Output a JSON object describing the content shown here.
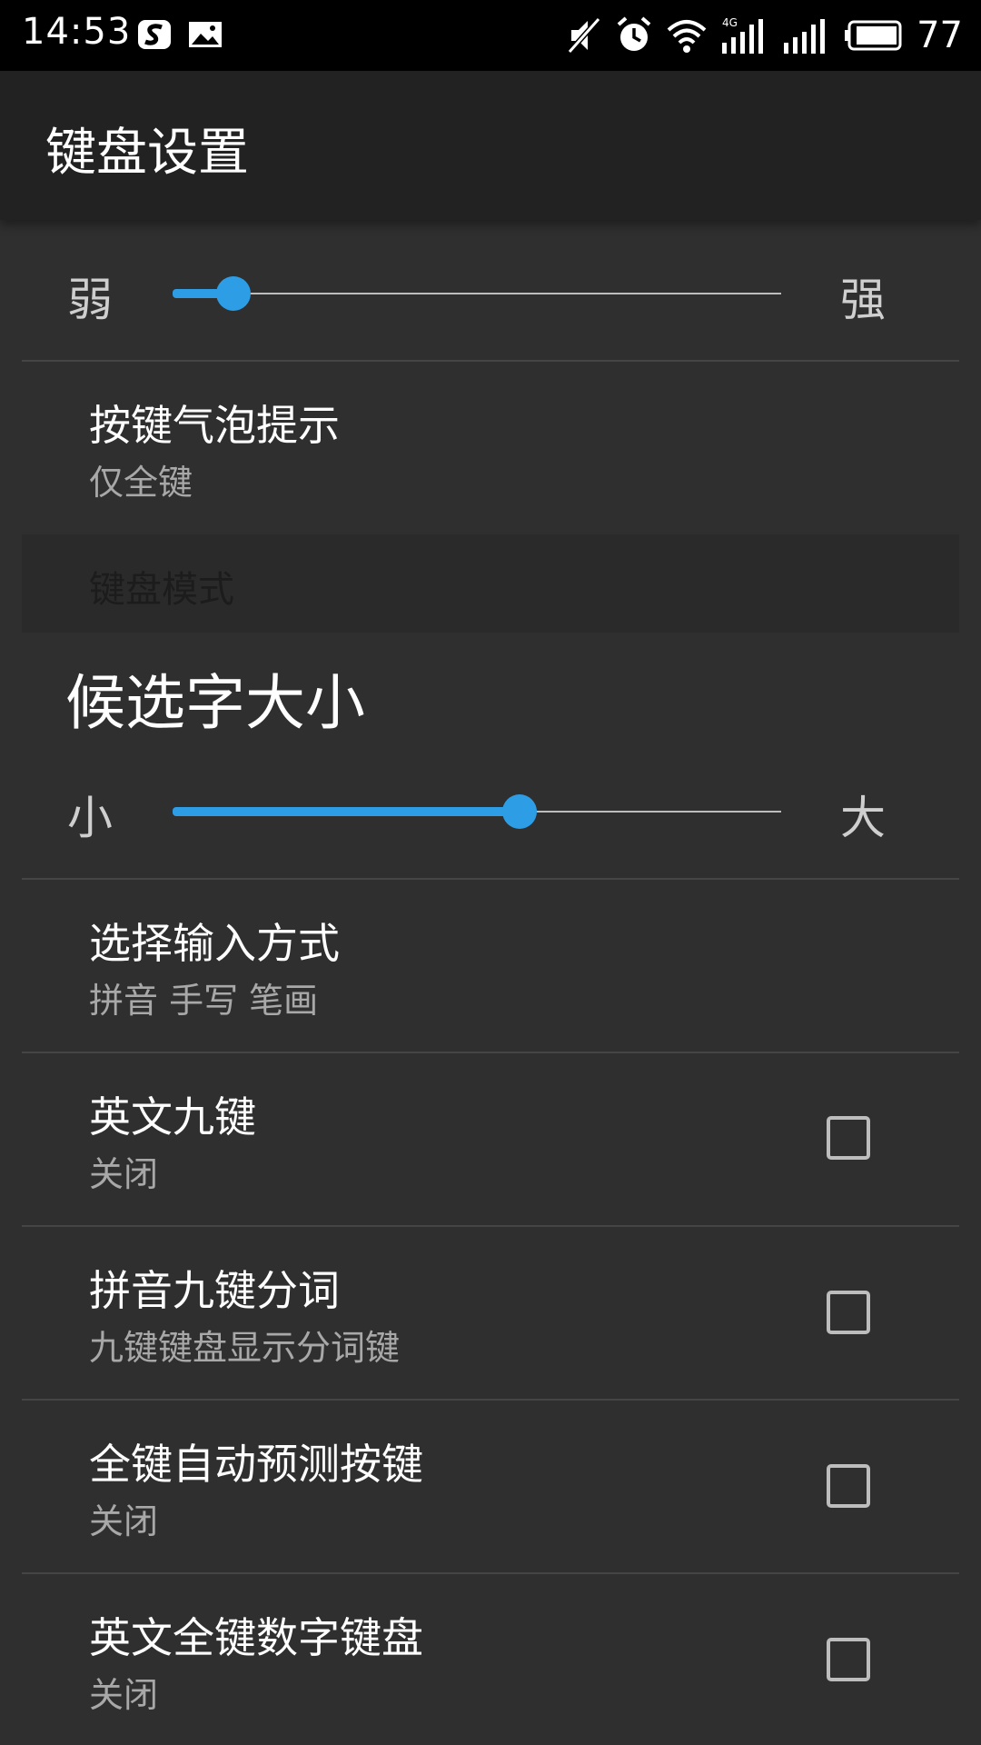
{
  "status_bar": {
    "time": "14:53",
    "battery": "77",
    "icons": [
      "sogou-app-icon",
      "gallery-icon",
      "mute-icon",
      "alarm-icon",
      "wifi-icon",
      "4g-signal-icon",
      "signal-icon",
      "battery-icon"
    ]
  },
  "app_bar": {
    "title": "键盘设置"
  },
  "vibration_slider": {
    "min_label": "弱",
    "max_label": "强",
    "value": 0.1
  },
  "key_bubble": {
    "title": "按键气泡提示",
    "summary": "仅全键"
  },
  "section": {
    "label": "键盘模式"
  },
  "candidate_size": {
    "heading": "候选字大小",
    "min_label": "小",
    "max_label": "大",
    "value": 0.57
  },
  "input_method": {
    "title": "选择输入方式",
    "summary": "拼音 手写 笔画"
  },
  "toggles": [
    {
      "title": "英文九键",
      "summary": "关闭",
      "checked": false
    },
    {
      "title": "拼音九键分词",
      "summary": "九键键盘显示分词键",
      "checked": false
    },
    {
      "title": "全键自动预测按键",
      "summary": "关闭",
      "checked": false
    },
    {
      "title": "英文全键数字键盘",
      "summary": "关闭",
      "checked": false
    }
  ],
  "colors": {
    "accent": "#2d9de6",
    "background": "#2f2f2f",
    "app_bar": "#222222"
  }
}
